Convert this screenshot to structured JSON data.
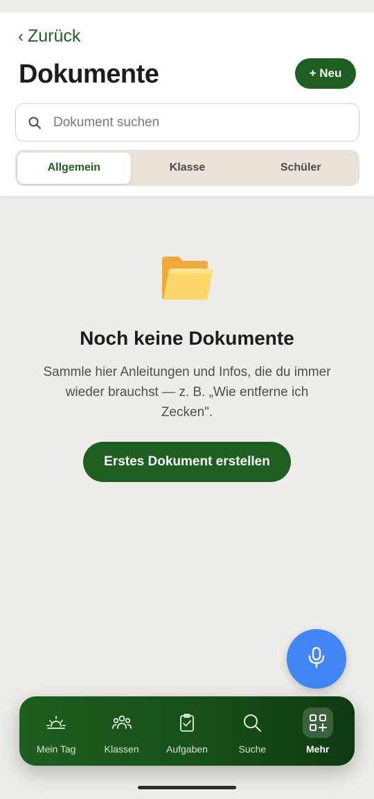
{
  "header": {
    "back_label": "Zurück",
    "title": "Dokumente",
    "new_button_label": "+ Neu"
  },
  "search": {
    "placeholder": "Dokument suchen"
  },
  "tabs": [
    {
      "label": "Allgemein",
      "active": true
    },
    {
      "label": "Klasse",
      "active": false
    },
    {
      "label": "Schüler",
      "active": false
    }
  ],
  "empty_state": {
    "icon": "folder-icon",
    "title": "Noch keine Dokumente",
    "description": "Sammle hier Anleitungen und Infos, die du immer wieder brauchst — z. B. „Wie entferne ich Zecken\".",
    "cta_label": "Erstes Dokument erstellen"
  },
  "fab": {
    "icon": "microphone-icon"
  },
  "bottom_nav": [
    {
      "label": "Mein Tag",
      "icon": "sunrise-icon",
      "active": false
    },
    {
      "label": "Klassen",
      "icon": "group-icon",
      "active": false
    },
    {
      "label": "Aufgaben",
      "icon": "clipboard-check-icon",
      "active": false
    },
    {
      "label": "Suche",
      "icon": "search-icon",
      "active": false
    },
    {
      "label": "Mehr",
      "icon": "grid-plus-icon",
      "active": true
    }
  ],
  "colors": {
    "brand_green": "#1E5E20",
    "fab_blue": "#4285F4",
    "background": "#EFEDE9",
    "segment_bg": "#E8E2D9"
  }
}
